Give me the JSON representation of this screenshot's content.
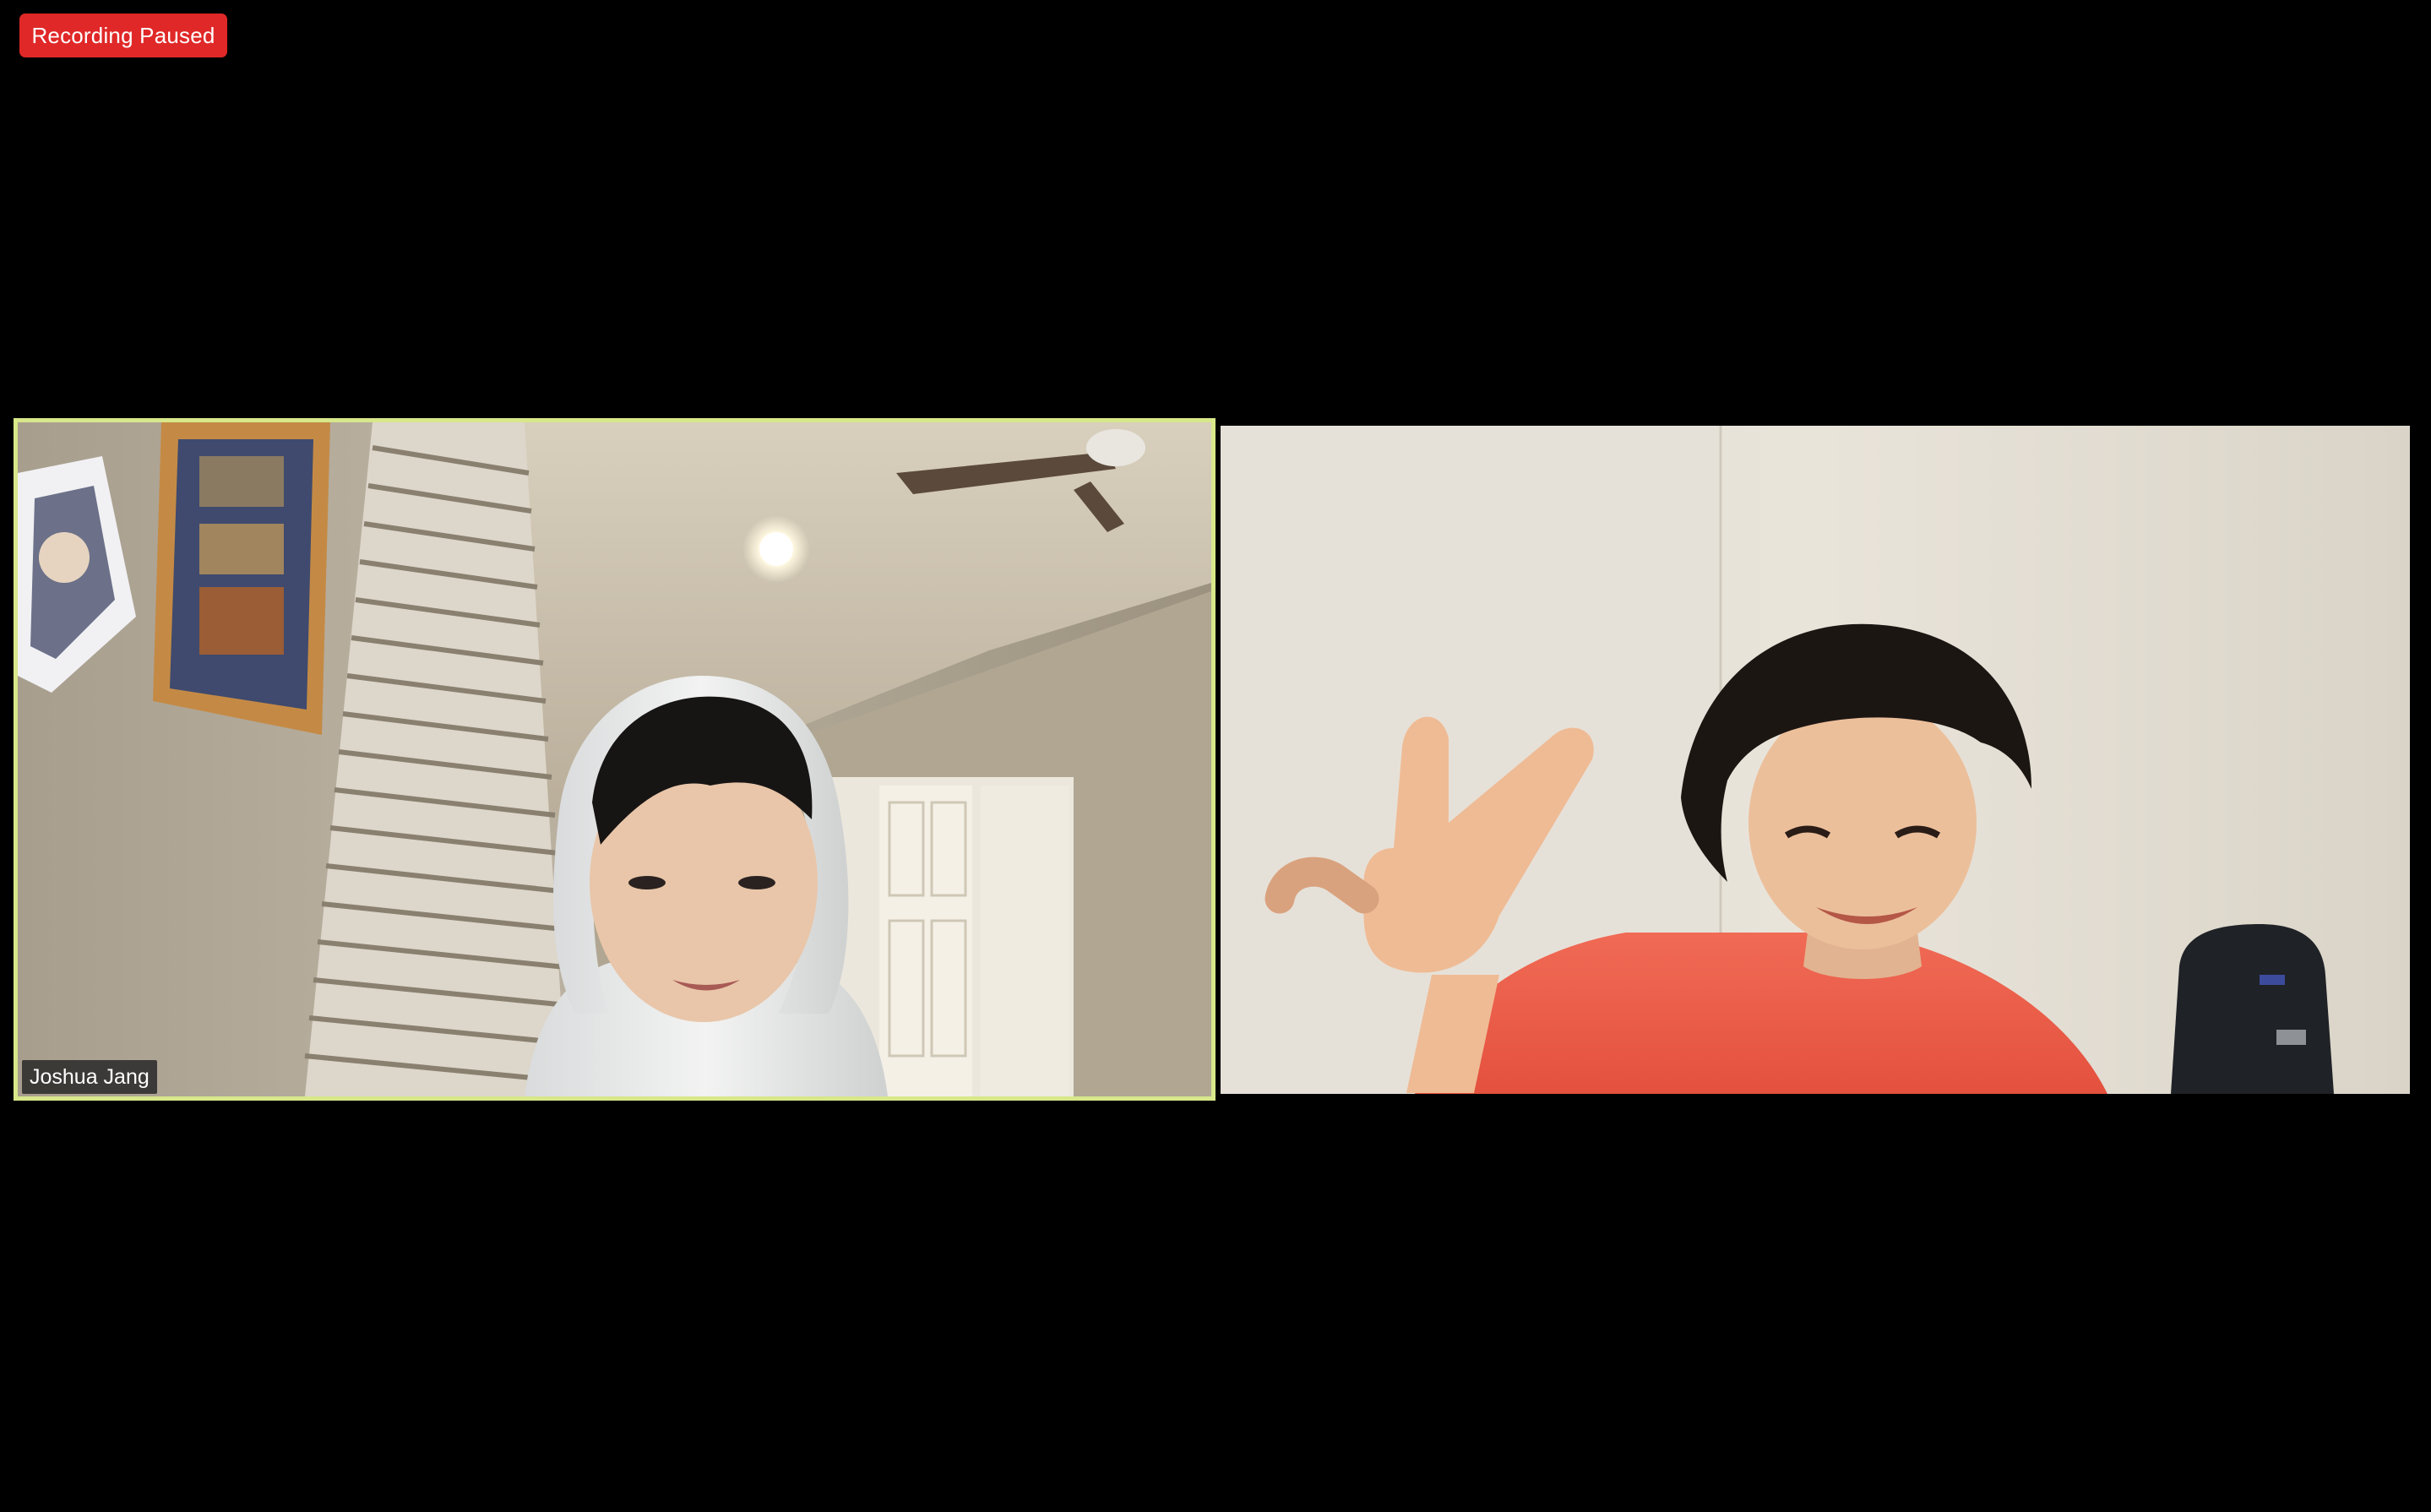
{
  "recording": {
    "status_label": "Recording Paused",
    "color": "#e02828"
  },
  "participants": [
    {
      "name": "Joshua Jang",
      "active_speaker": true,
      "highlight_color": "#d7e78a"
    },
    {
      "name": "",
      "active_speaker": false
    }
  ]
}
